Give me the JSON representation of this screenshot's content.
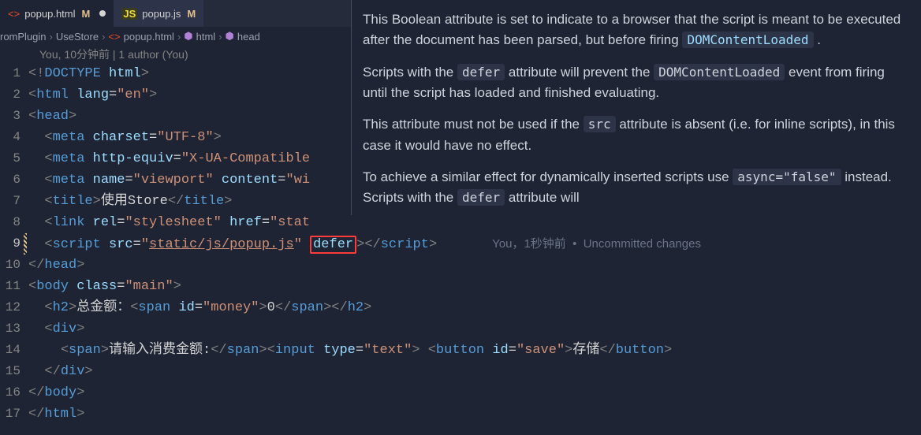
{
  "tabs": [
    {
      "icon": "<>",
      "label": "popup.html",
      "modified": "M",
      "active": true,
      "dirty": true
    },
    {
      "icon": "JS",
      "label": "popup.js",
      "modified": "M",
      "active": false,
      "dirty": false
    }
  ],
  "breadcrumb": {
    "seg0": "romPlugin",
    "seg1": "UseStore",
    "seg2": "popup.html",
    "seg3": "html",
    "seg4": "head"
  },
  "code_lens": "You, 10分钟前 | 1 author (You)",
  "inline_blame": "You，1秒钟前  •  Uncommitted changes",
  "gutter": [
    "1",
    "2",
    "3",
    "4",
    "5",
    "6",
    "7",
    "8",
    "9",
    "10",
    "11",
    "12",
    "13",
    "14",
    "15",
    "16",
    "17"
  ],
  "code": {
    "l1": {
      "a": "<!",
      "b": "DOCTYPE ",
      "c": "html",
      "d": ">"
    },
    "l2": {
      "a": "<",
      "b": "html ",
      "c": "lang",
      "d": "=",
      "e": "\"en\"",
      "f": ">"
    },
    "l3": {
      "a": "<",
      "b": "head",
      "c": ">"
    },
    "l4": {
      "a": "<",
      "b": "meta ",
      "c": "charset",
      "d": "=",
      "e": "\"UTF-8\"",
      "f": ">"
    },
    "l5": {
      "a": "<",
      "b": "meta ",
      "c": "http-equiv",
      "d": "=",
      "e": "\"X-UA-Compatible"
    },
    "l6": {
      "a": "<",
      "b": "meta ",
      "c": "name",
      "d": "=",
      "e": "\"viewport\"",
      "f": " ",
      "g": "content",
      "h": "=",
      "i": "\"wi"
    },
    "l7": {
      "a": "<",
      "b": "title",
      "c": ">",
      "d": "使用Store",
      "e": "</",
      "f": "title",
      "g": ">"
    },
    "l8": {
      "a": "<",
      "b": "link ",
      "c": "rel",
      "d": "=",
      "e": "\"stylesheet\"",
      "f": " ",
      "g": "href",
      "h": "=",
      "i": "\"stat"
    },
    "l9": {
      "a": "<",
      "b": "script ",
      "c": "src",
      "d": "=",
      "e": "\"",
      "f": "static/js/popup.js",
      "g": "\"",
      "h": " ",
      "i": "defer",
      "j": ">",
      "k": "</",
      "l": "script",
      "m": ">"
    },
    "l10": {
      "a": "</",
      "b": "head",
      "c": ">"
    },
    "l11": {
      "a": "<",
      "b": "body ",
      "c": "class",
      "d": "=",
      "e": "\"main\"",
      "f": ">"
    },
    "l12": {
      "a": "<",
      "b": "h2",
      "c": ">",
      "d": "总金额：",
      "e": "<",
      "f": "span ",
      "g": "id",
      "h": "=",
      "i": "\"money\"",
      "j": ">",
      "k": "0",
      "l": "</",
      "m": "span",
      "n": ">",
      "o": "</",
      "p": "h2",
      "q": ">"
    },
    "l13": {
      "a": "<",
      "b": "div",
      "c": ">"
    },
    "l14": {
      "a": "<",
      "b": "span",
      "c": ">",
      "d": "请输入消费金额:",
      "e": "</",
      "f": "span",
      "g": ">",
      "h": "<",
      "i": "input ",
      "j": "type",
      "k": "=",
      "l": "\"text\"",
      "m": ">",
      "n": " ",
      "o": "<",
      "p": "button ",
      "q": "id",
      "r": "=",
      "s": "\"save\"",
      "t": ">",
      "u": "存储",
      "v": "</",
      "w": "button",
      "x": ">"
    },
    "l15": {
      "a": "</",
      "b": "div",
      "c": ">"
    },
    "l16": {
      "a": "</",
      "b": "body",
      "c": ">"
    },
    "l17": {
      "a": "</",
      "b": "html",
      "c": ">"
    }
  },
  "hover": {
    "p1a": "This Boolean attribute is set to indicate to a browser that the script is meant to be executed after the document has been parsed, but before firing ",
    "p1code": "DOMContentLoaded",
    "p1b": " .",
    "p2a": "Scripts with the ",
    "p2code1": "defer",
    "p2b": " attribute will prevent the ",
    "p2code2": "DOMContentLoaded",
    "p2c": " event from firing until the script has loaded and finished evaluating.",
    "p3a": "This attribute must not be used if the ",
    "p3code": "src",
    "p3b": " attribute is absent (i.e. for inline scripts), in this case it would have no effect.",
    "p4a": "To achieve a similar effect for dynamically inserted scripts use ",
    "p4code1": "async=\"false\"",
    "p4b": " instead. Scripts with the ",
    "p4code2": "defer",
    "p4c": " attribute will"
  }
}
